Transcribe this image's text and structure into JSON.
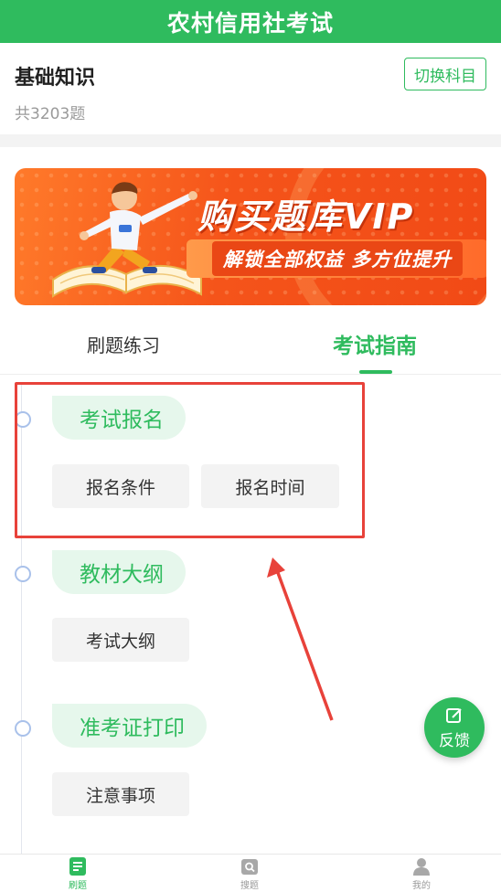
{
  "header": {
    "title": "农村信用社考试"
  },
  "subject": {
    "name": "基础知识",
    "count": "共3203题",
    "switch_label": "切换科目"
  },
  "banner": {
    "title": "购买题库VIP",
    "subtitle": "解锁全部权益  多方位提升"
  },
  "tabs": [
    {
      "label": "刷题练习",
      "active": false
    },
    {
      "label": "考试指南",
      "active": true
    }
  ],
  "sections": [
    {
      "title": "考试报名",
      "items": [
        "报名条件",
        "报名时间"
      ]
    },
    {
      "title": "教材大纲",
      "items": [
        "考试大纲"
      ]
    },
    {
      "title": "准考证打印",
      "items": [
        "注意事项"
      ]
    }
  ],
  "feedback": {
    "label": "反馈"
  },
  "bottom_nav": [
    {
      "label": "刷题",
      "icon": "document-icon",
      "active": true
    },
    {
      "label": "搜题",
      "icon": "search-photo-icon",
      "active": false
    },
    {
      "label": "我的",
      "icon": "user-icon",
      "active": false
    }
  ],
  "colors": {
    "brand_green": "#2fbb5e",
    "annotation_red": "#e8423a",
    "banner_orange": "#f5541a"
  }
}
